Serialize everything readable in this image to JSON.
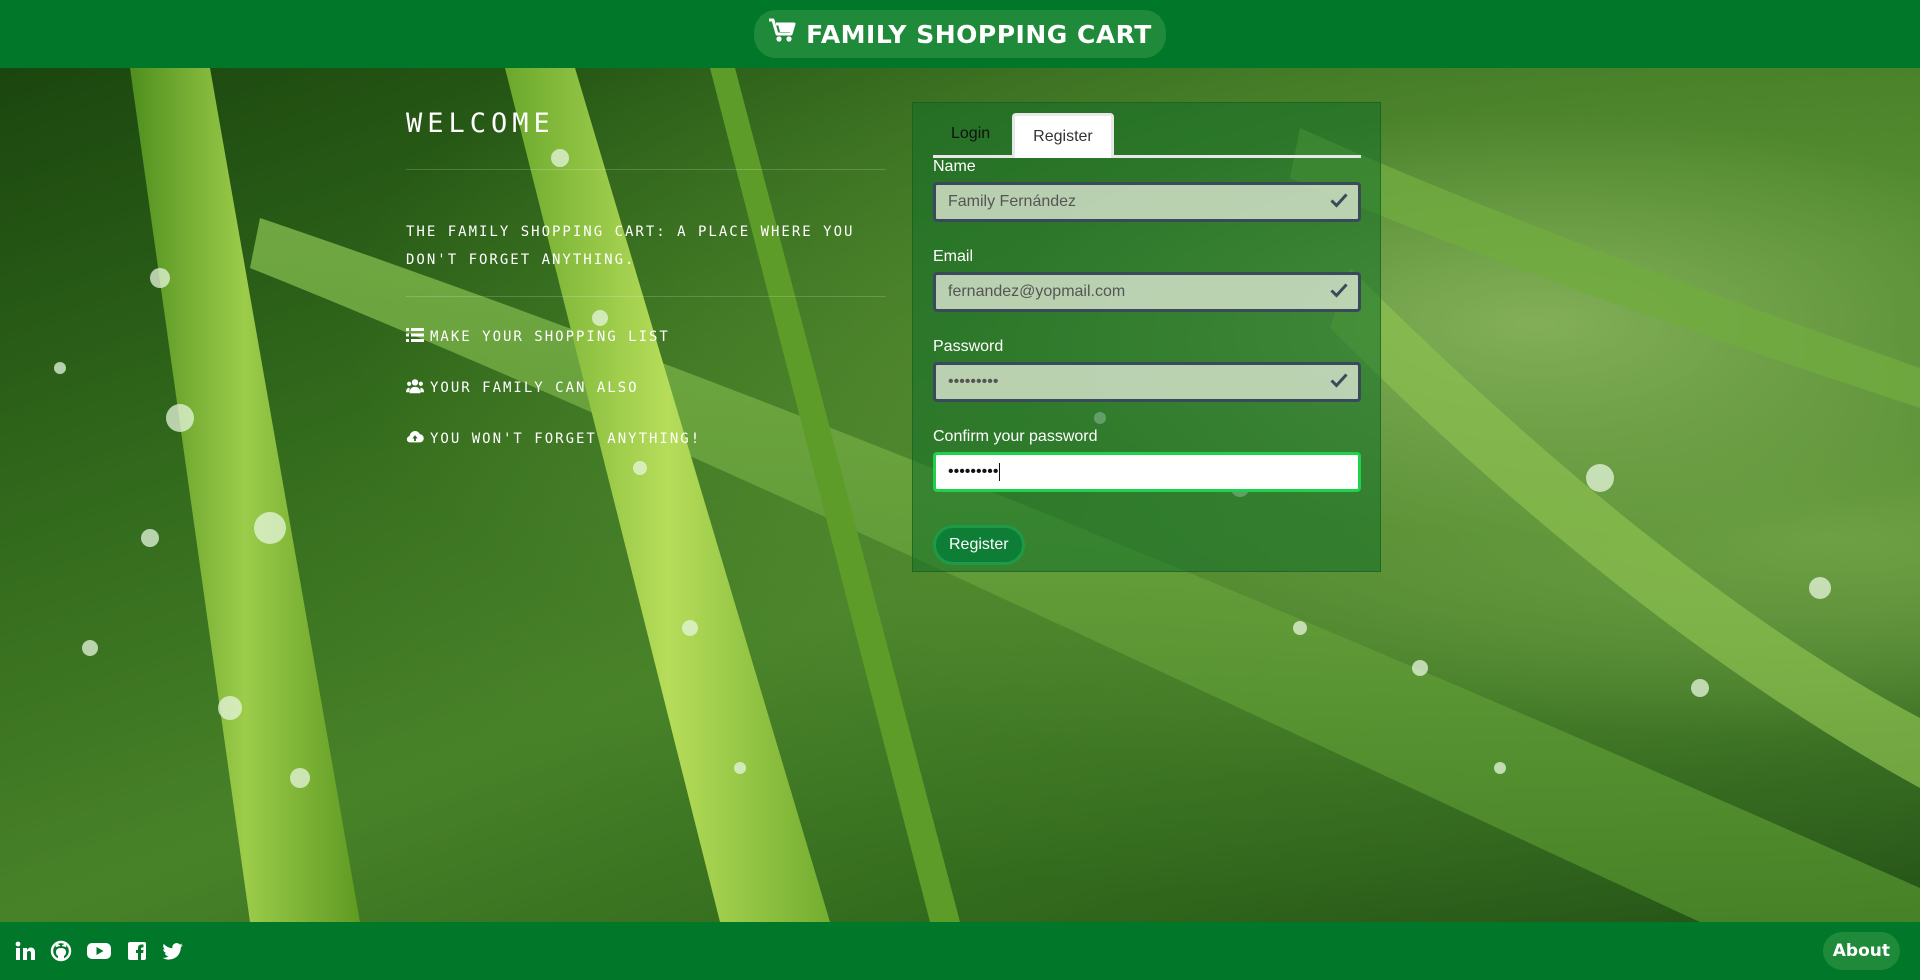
{
  "header": {
    "brand_title": "FAMILY SHOPPING CART",
    "brand_icon": "cart-icon"
  },
  "welcome": {
    "title": "WELCOME",
    "description": "The family shopping cart: a place where you don't forget anything.",
    "features": [
      {
        "icon": "list-icon",
        "label": "Make your shopping list"
      },
      {
        "icon": "users-icon",
        "label": "Your family can also"
      },
      {
        "icon": "cloud-upload-icon",
        "label": "You won't forget anything!"
      }
    ]
  },
  "tabs": {
    "login": "Login",
    "register": "Register",
    "active": "register"
  },
  "form": {
    "name_label": "Name",
    "name_value": "Family Fernández",
    "email_label": "Email",
    "email_value": "fernandez@yopmail.com",
    "password_label": "Password",
    "password_value": "•••••••••",
    "confirm_label": "Confirm your password",
    "confirm_value": "•••••••••",
    "submit_label": "Register"
  },
  "footer": {
    "social": [
      "linkedin-icon",
      "github-icon",
      "youtube-icon",
      "facebook-icon",
      "twitter-icon"
    ],
    "about_label": "About"
  },
  "colors": {
    "bar_green": "#017729",
    "focus_green": "#1fd14c"
  }
}
